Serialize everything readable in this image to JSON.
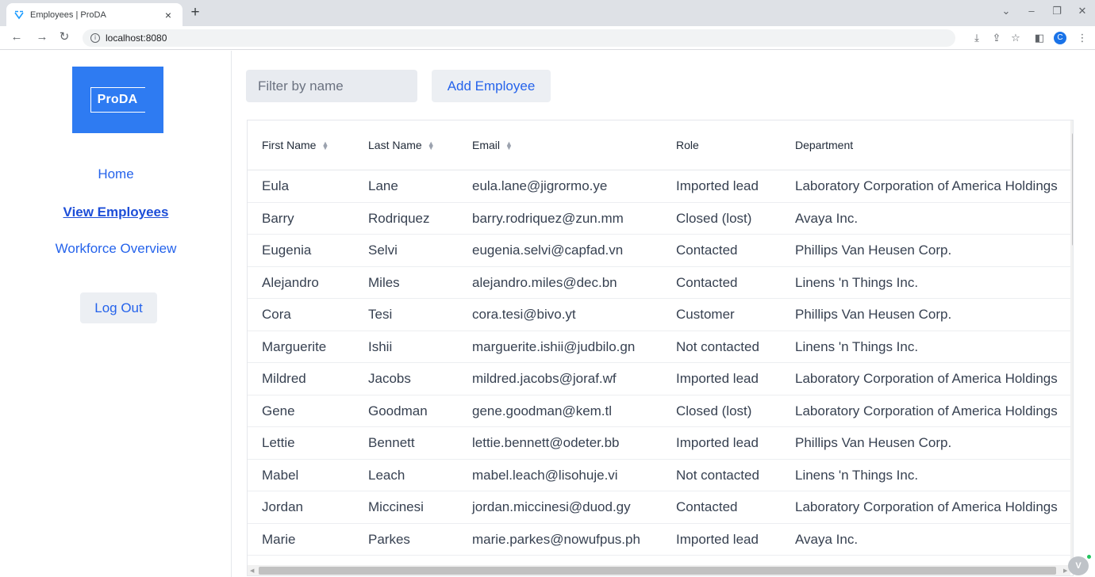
{
  "browser": {
    "tab_title": "Employees | ProDA",
    "tab_close": "×",
    "new_tab": "+",
    "url": "localhost:8080",
    "info_glyph": "i",
    "profile_initial": "C",
    "icons": [
      "back-arrow-icon",
      "forward-arrow-icon",
      "reload-icon",
      "install-app-icon",
      "share-icon",
      "bookmark-star-icon",
      "side-panel-icon",
      "kebab-menu-icon"
    ]
  },
  "sidebar": {
    "logo_text": "ProDA",
    "nav": [
      {
        "label": "Home",
        "active": false
      },
      {
        "label": "View Employees",
        "active": true
      },
      {
        "label": "Workforce Overview",
        "active": false
      }
    ],
    "logout_label": "Log Out"
  },
  "toolbar": {
    "filter_placeholder": "Filter by name",
    "add_label": "Add Employee"
  },
  "table": {
    "columns": [
      {
        "label": "First Name",
        "sortable": true
      },
      {
        "label": "Last Name",
        "sortable": true
      },
      {
        "label": "Email",
        "sortable": true
      },
      {
        "label": "Role",
        "sortable": false
      },
      {
        "label": "Department",
        "sortable": false
      }
    ],
    "rows": [
      [
        "Eula",
        "Lane",
        "eula.lane@jigrormo.ye",
        "Imported lead",
        "Laboratory Corporation of America Holdings"
      ],
      [
        "Barry",
        "Rodriquez",
        "barry.rodriquez@zun.mm",
        "Closed (lost)",
        "Avaya Inc."
      ],
      [
        "Eugenia",
        "Selvi",
        "eugenia.selvi@capfad.vn",
        "Contacted",
        "Phillips Van Heusen Corp."
      ],
      [
        "Alejandro",
        "Miles",
        "alejandro.miles@dec.bn",
        "Contacted",
        "Linens 'n Things Inc."
      ],
      [
        "Cora",
        "Tesi",
        "cora.tesi@bivo.yt",
        "Customer",
        "Phillips Van Heusen Corp."
      ],
      [
        "Marguerite",
        "Ishii",
        "marguerite.ishii@judbilo.gn",
        "Not contacted",
        "Linens 'n Things Inc."
      ],
      [
        "Mildred",
        "Jacobs",
        "mildred.jacobs@joraf.wf",
        "Imported lead",
        "Laboratory Corporation of America Holdings"
      ],
      [
        "Gene",
        "Goodman",
        "gene.goodman@kem.tl",
        "Closed (lost)",
        "Laboratory Corporation of America Holdings"
      ],
      [
        "Lettie",
        "Bennett",
        "lettie.bennett@odeter.bb",
        "Imported lead",
        "Phillips Van Heusen Corp."
      ],
      [
        "Mabel",
        "Leach",
        "mabel.leach@lisohuje.vi",
        "Not contacted",
        "Linens 'n Things Inc."
      ],
      [
        "Jordan",
        "Miccinesi",
        "jordan.miccinesi@duod.gy",
        "Contacted",
        "Laboratory Corporation of America Holdings"
      ],
      [
        "Marie",
        "Parkes",
        "marie.parkes@nowufpus.ph",
        "Imported lead",
        "Avaya Inc."
      ]
    ]
  },
  "colors": {
    "accent": "#2563eb",
    "logo_bg": "#2e7bf2"
  }
}
